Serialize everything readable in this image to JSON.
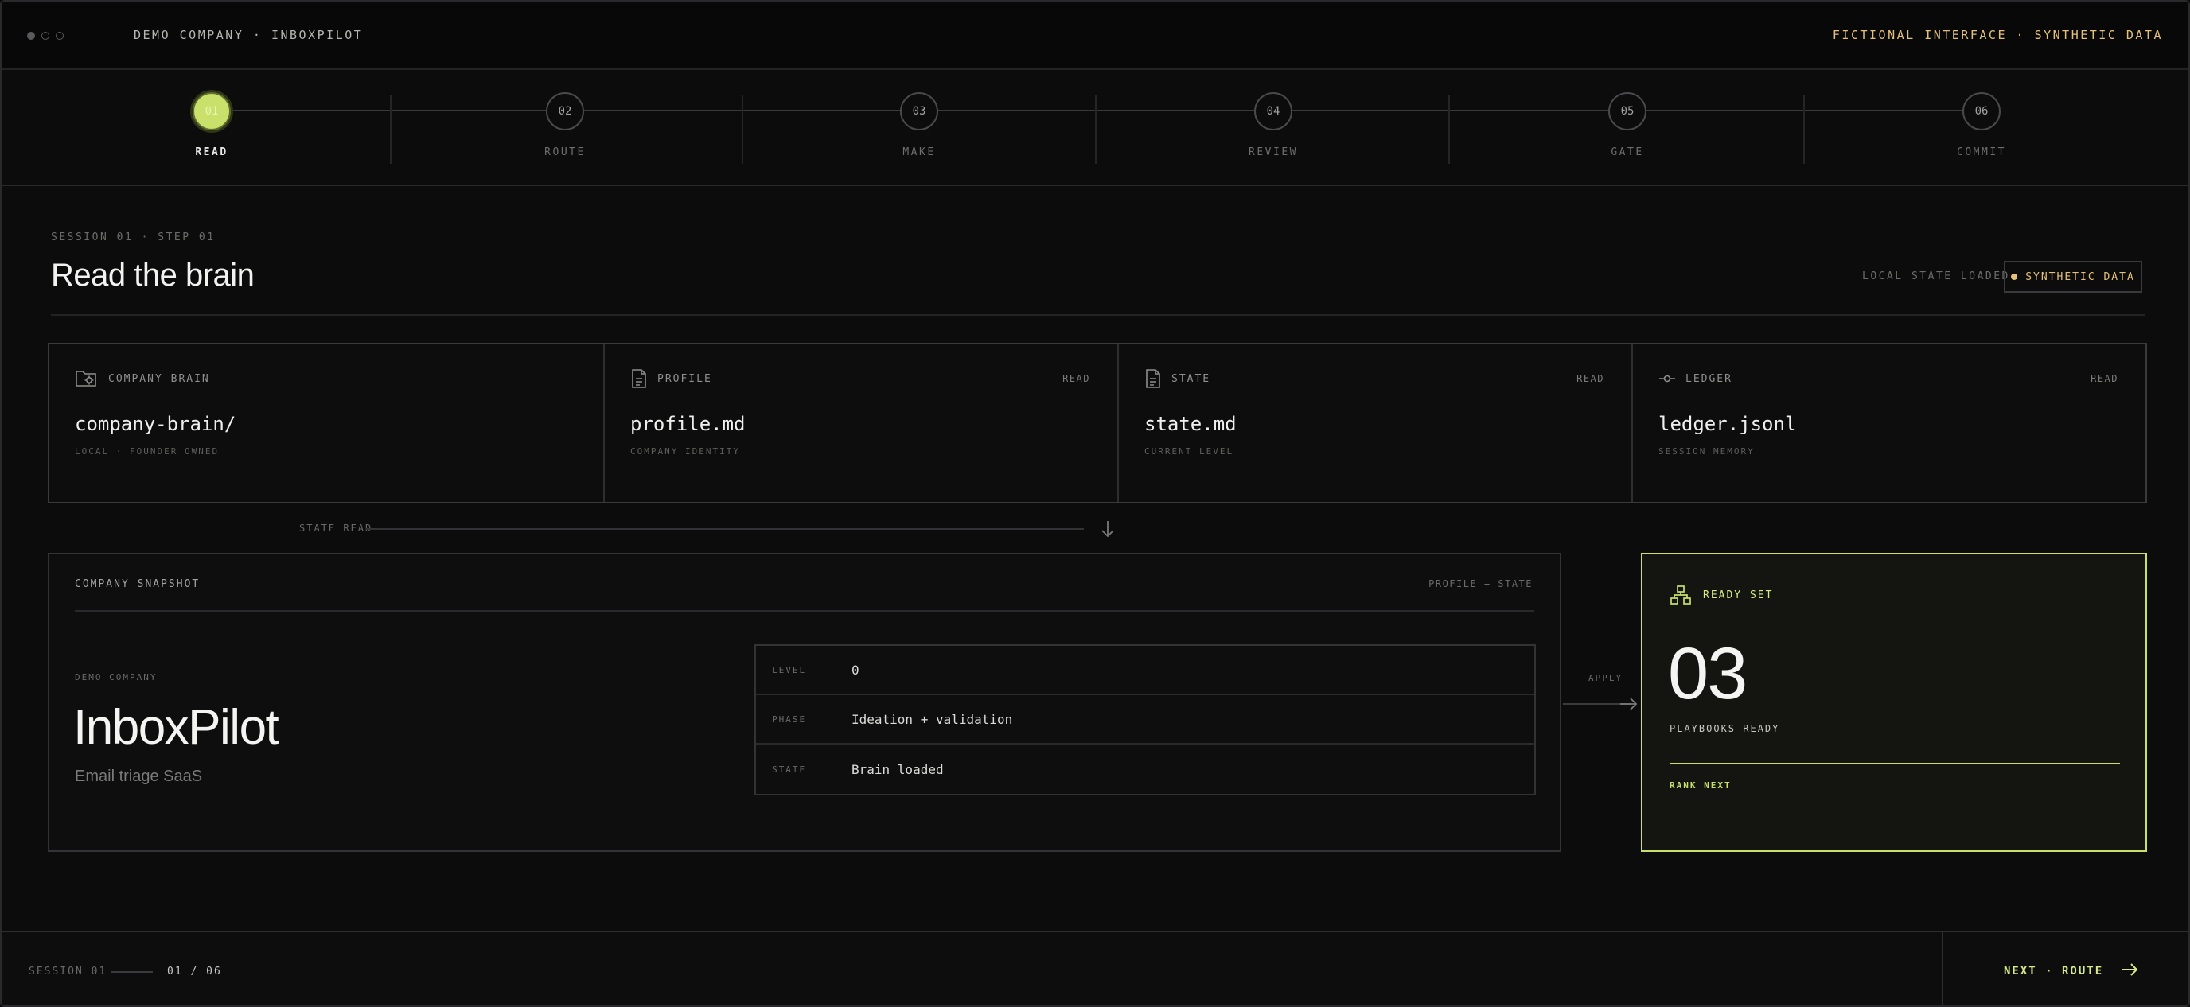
{
  "window": {
    "title": "DEMO COMPANY · INBOXPILOT",
    "notice": "FICTIONAL INTERFACE · SYNTHETIC DATA"
  },
  "stepper": {
    "steps": [
      {
        "num": "01",
        "label": "READ",
        "active": true
      },
      {
        "num": "02",
        "label": "ROUTE"
      },
      {
        "num": "03",
        "label": "MAKE"
      },
      {
        "num": "04",
        "label": "REVIEW"
      },
      {
        "num": "05",
        "label": "GATE"
      },
      {
        "num": "06",
        "label": "COMMIT"
      }
    ]
  },
  "header": {
    "crumb": "SESSION 01 · STEP 01",
    "title": "Read the brain",
    "status": "LOCAL STATE LOADED",
    "badge": "SYNTHETIC DATA"
  },
  "sources": [
    {
      "icon": "folder-gear-icon",
      "label": "COMPANY BRAIN",
      "file": "company-brain/",
      "sub": "LOCAL · FOUNDER OWNED"
    },
    {
      "icon": "document-icon",
      "label": "PROFILE",
      "read": "READ",
      "file": "profile.md",
      "sub": "COMPANY IDENTITY"
    },
    {
      "icon": "document-icon",
      "label": "STATE",
      "read": "READ",
      "file": "state.md",
      "sub": "CURRENT LEVEL"
    },
    {
      "icon": "commit-icon",
      "label": "LEDGER",
      "read": "READ",
      "file": "ledger.jsonl",
      "sub": "SESSION MEMORY"
    }
  ],
  "connector": {
    "label": "STATE READ"
  },
  "snapshot": {
    "title": "COMPANY SNAPSHOT",
    "source": "PROFILE + STATE",
    "company_label": "DEMO COMPANY",
    "company_name": "InboxPilot",
    "tagline": "Email triage SaaS",
    "fields": [
      {
        "key": "LEVEL",
        "value": "0"
      },
      {
        "key": "PHASE",
        "value": "Ideation + validation"
      },
      {
        "key": "STATE",
        "value": "Brain loaded"
      }
    ]
  },
  "apply": {
    "label": "APPLY"
  },
  "ready": {
    "title": "READY SET",
    "count": "03",
    "subtitle": "PLAYBOOKS READY",
    "action": "RANK NEXT"
  },
  "footer": {
    "session": "SESSION 01",
    "progress": "01 / 06",
    "next": "NEXT · ROUTE"
  },
  "colors": {
    "accent": "#c9e06a",
    "warning": "#e4c07a",
    "background": "#0c0c0d"
  }
}
